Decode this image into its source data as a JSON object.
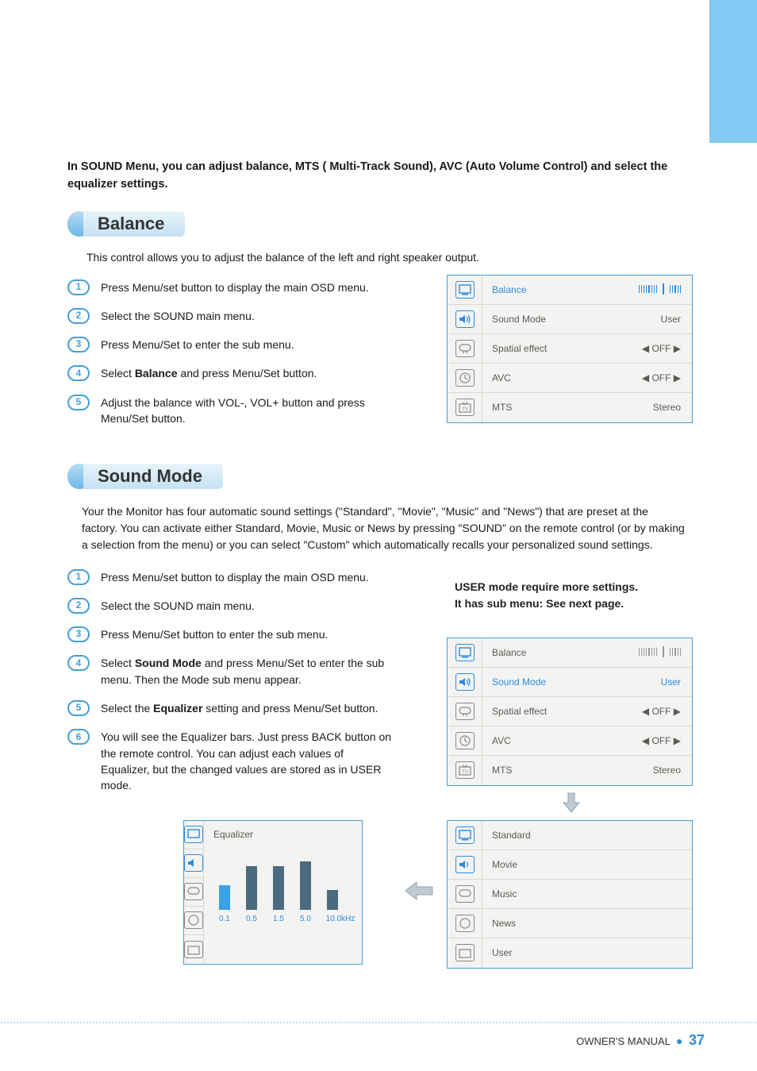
{
  "intro": "In SOUND Menu, you can adjust balance, MTS ( Multi-Track Sound), AVC (Auto Volume Control) and select the equalizer settings.",
  "sections": {
    "balance": {
      "title": "Balance",
      "desc": "This control allows you to adjust the balance of the left and right speaker output.",
      "steps": [
        "Press Menu/set button to display the main OSD menu.",
        "Select the SOUND main menu.",
        "Press Menu/Set to enter the sub menu.",
        "Select Balance and press Menu/Set button.",
        "Adjust the balance with VOL-, VOL+ button and press Menu/Set button."
      ]
    },
    "sound_mode": {
      "title": "Sound Mode",
      "desc": "Your the Monitor has four automatic sound settings (\"Standard\", \"Movie\", \"Music\" and \"News\") that  are preset at the factory. You can activate either Standard, Movie, Music or News by pressing  \"SOUND\" on the remote control (or by making a selection from the menu) or you can select  \"Custom\" which automatically recalls your personalized sound settings.",
      "steps": [
        "Press Menu/set button to display the main OSD menu.",
        "Select the SOUND main menu.",
        "Press Menu/Set button to enter the sub menu.",
        "Select Sound Mode and press Menu/Set to enter the sub menu. Then the Mode sub menu appear.",
        "Select the Equalizer setting and press Menu/Set button.",
        "You will see the Equalizer bars. Just press BACK button on the remote control. You can adjust each values of Equalizer, but the changed values are stored as in USER mode."
      ],
      "note1": "USER mode require more settings.",
      "note2": "It has sub menu: See next page."
    }
  },
  "osd_balance": {
    "items": [
      {
        "label": "Balance",
        "value": "slider",
        "active": true
      },
      {
        "label": "Sound Mode",
        "value": "User"
      },
      {
        "label": "Spatial effect",
        "value": "◀ OFF ▶"
      },
      {
        "label": "AVC",
        "value": "◀ OFF ▶"
      },
      {
        "label": "MTS",
        "value": "Stereo"
      }
    ]
  },
  "osd_sound": {
    "items": [
      {
        "label": "Balance",
        "value": "slider"
      },
      {
        "label": "Sound Mode",
        "value": "User",
        "active": true
      },
      {
        "label": "Spatial effect",
        "value": "◀ OFF ▶"
      },
      {
        "label": "AVC",
        "value": "◀ OFF ▶"
      },
      {
        "label": "MTS",
        "value": "Stereo"
      }
    ]
  },
  "osd_modes": {
    "items": [
      "Standard",
      "Movie",
      "Music",
      "News",
      "User"
    ]
  },
  "equalizer": {
    "title": "Equalizer",
    "labels": [
      "0.1",
      "0.5",
      "1.5",
      "5.0",
      "10.0kHz"
    ]
  },
  "chart_data": {
    "type": "bar",
    "title": "Equalizer",
    "categories": [
      "0.1",
      "0.5",
      "1.5",
      "5.0",
      "10.0kHz"
    ],
    "values": [
      40,
      70,
      70,
      78,
      32
    ],
    "ylim": [
      0,
      100
    ],
    "xlabel": "kHz",
    "ylabel": ""
  },
  "footer": {
    "label": "OWNER'S MANUAL",
    "page": "37"
  }
}
